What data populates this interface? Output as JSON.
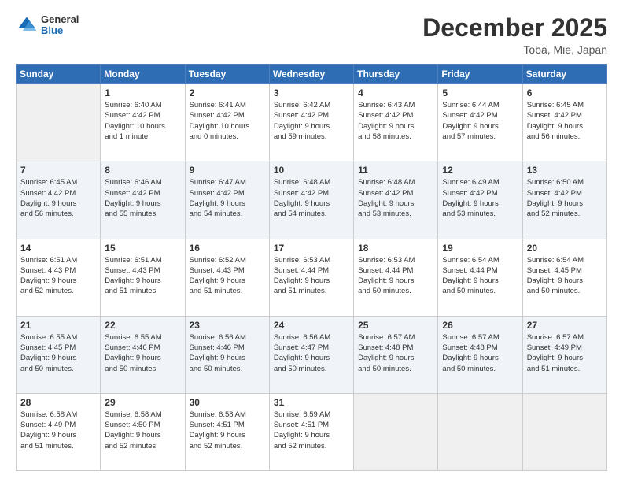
{
  "logo": {
    "general": "General",
    "blue": "Blue"
  },
  "header": {
    "month": "December 2025",
    "location": "Toba, Mie, Japan"
  },
  "days_of_week": [
    "Sunday",
    "Monday",
    "Tuesday",
    "Wednesday",
    "Thursday",
    "Friday",
    "Saturday"
  ],
  "weeks": [
    [
      {
        "day": "",
        "info": ""
      },
      {
        "day": "1",
        "info": "Sunrise: 6:40 AM\nSunset: 4:42 PM\nDaylight: 10 hours\nand 1 minute."
      },
      {
        "day": "2",
        "info": "Sunrise: 6:41 AM\nSunset: 4:42 PM\nDaylight: 10 hours\nand 0 minutes."
      },
      {
        "day": "3",
        "info": "Sunrise: 6:42 AM\nSunset: 4:42 PM\nDaylight: 9 hours\nand 59 minutes."
      },
      {
        "day": "4",
        "info": "Sunrise: 6:43 AM\nSunset: 4:42 PM\nDaylight: 9 hours\nand 58 minutes."
      },
      {
        "day": "5",
        "info": "Sunrise: 6:44 AM\nSunset: 4:42 PM\nDaylight: 9 hours\nand 57 minutes."
      },
      {
        "day": "6",
        "info": "Sunrise: 6:45 AM\nSunset: 4:42 PM\nDaylight: 9 hours\nand 56 minutes."
      }
    ],
    [
      {
        "day": "7",
        "info": "Sunrise: 6:45 AM\nSunset: 4:42 PM\nDaylight: 9 hours\nand 56 minutes."
      },
      {
        "day": "8",
        "info": "Sunrise: 6:46 AM\nSunset: 4:42 PM\nDaylight: 9 hours\nand 55 minutes."
      },
      {
        "day": "9",
        "info": "Sunrise: 6:47 AM\nSunset: 4:42 PM\nDaylight: 9 hours\nand 54 minutes."
      },
      {
        "day": "10",
        "info": "Sunrise: 6:48 AM\nSunset: 4:42 PM\nDaylight: 9 hours\nand 54 minutes."
      },
      {
        "day": "11",
        "info": "Sunrise: 6:48 AM\nSunset: 4:42 PM\nDaylight: 9 hours\nand 53 minutes."
      },
      {
        "day": "12",
        "info": "Sunrise: 6:49 AM\nSunset: 4:42 PM\nDaylight: 9 hours\nand 53 minutes."
      },
      {
        "day": "13",
        "info": "Sunrise: 6:50 AM\nSunset: 4:42 PM\nDaylight: 9 hours\nand 52 minutes."
      }
    ],
    [
      {
        "day": "14",
        "info": "Sunrise: 6:51 AM\nSunset: 4:43 PM\nDaylight: 9 hours\nand 52 minutes."
      },
      {
        "day": "15",
        "info": "Sunrise: 6:51 AM\nSunset: 4:43 PM\nDaylight: 9 hours\nand 51 minutes."
      },
      {
        "day": "16",
        "info": "Sunrise: 6:52 AM\nSunset: 4:43 PM\nDaylight: 9 hours\nand 51 minutes."
      },
      {
        "day": "17",
        "info": "Sunrise: 6:53 AM\nSunset: 4:44 PM\nDaylight: 9 hours\nand 51 minutes."
      },
      {
        "day": "18",
        "info": "Sunrise: 6:53 AM\nSunset: 4:44 PM\nDaylight: 9 hours\nand 50 minutes."
      },
      {
        "day": "19",
        "info": "Sunrise: 6:54 AM\nSunset: 4:44 PM\nDaylight: 9 hours\nand 50 minutes."
      },
      {
        "day": "20",
        "info": "Sunrise: 6:54 AM\nSunset: 4:45 PM\nDaylight: 9 hours\nand 50 minutes."
      }
    ],
    [
      {
        "day": "21",
        "info": "Sunrise: 6:55 AM\nSunset: 4:45 PM\nDaylight: 9 hours\nand 50 minutes."
      },
      {
        "day": "22",
        "info": "Sunrise: 6:55 AM\nSunset: 4:46 PM\nDaylight: 9 hours\nand 50 minutes."
      },
      {
        "day": "23",
        "info": "Sunrise: 6:56 AM\nSunset: 4:46 PM\nDaylight: 9 hours\nand 50 minutes."
      },
      {
        "day": "24",
        "info": "Sunrise: 6:56 AM\nSunset: 4:47 PM\nDaylight: 9 hours\nand 50 minutes."
      },
      {
        "day": "25",
        "info": "Sunrise: 6:57 AM\nSunset: 4:48 PM\nDaylight: 9 hours\nand 50 minutes."
      },
      {
        "day": "26",
        "info": "Sunrise: 6:57 AM\nSunset: 4:48 PM\nDaylight: 9 hours\nand 50 minutes."
      },
      {
        "day": "27",
        "info": "Sunrise: 6:57 AM\nSunset: 4:49 PM\nDaylight: 9 hours\nand 51 minutes."
      }
    ],
    [
      {
        "day": "28",
        "info": "Sunrise: 6:58 AM\nSunset: 4:49 PM\nDaylight: 9 hours\nand 51 minutes."
      },
      {
        "day": "29",
        "info": "Sunrise: 6:58 AM\nSunset: 4:50 PM\nDaylight: 9 hours\nand 52 minutes."
      },
      {
        "day": "30",
        "info": "Sunrise: 6:58 AM\nSunset: 4:51 PM\nDaylight: 9 hours\nand 52 minutes."
      },
      {
        "day": "31",
        "info": "Sunrise: 6:59 AM\nSunset: 4:51 PM\nDaylight: 9 hours\nand 52 minutes."
      },
      {
        "day": "",
        "info": ""
      },
      {
        "day": "",
        "info": ""
      },
      {
        "day": "",
        "info": ""
      }
    ]
  ]
}
